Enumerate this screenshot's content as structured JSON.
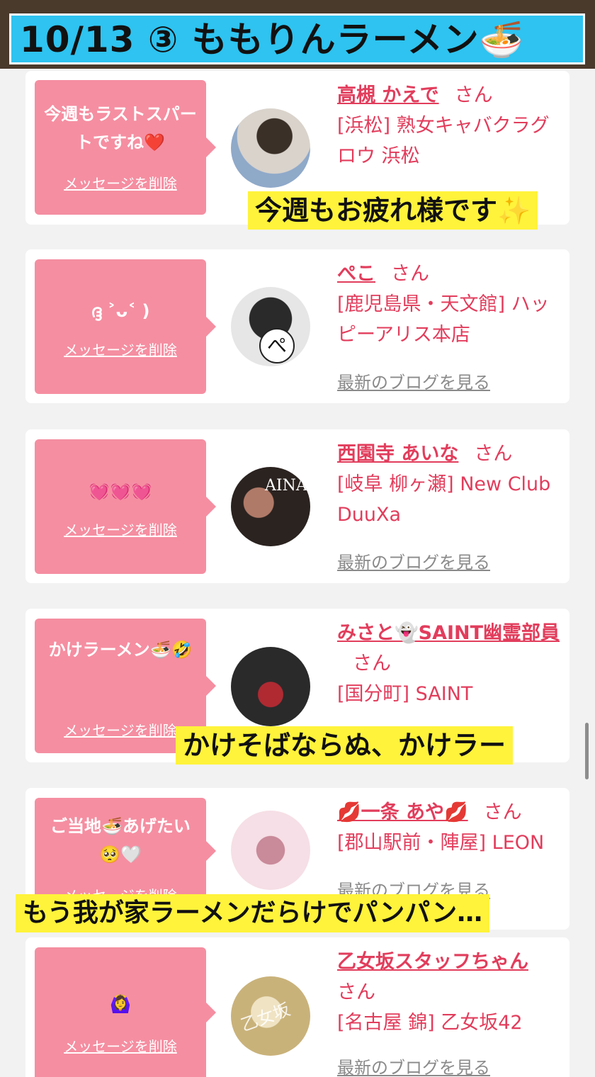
{
  "header": {
    "title": "10/13 ③ ももりんラーメン🍜"
  },
  "common": {
    "delete_label": "メッセージを削除",
    "san": "さん",
    "blog_label": "最新のブログを見る"
  },
  "cards": [
    {
      "message": "今週もラストスパートですね❤️",
      "name": "高槻 かえで",
      "shop": "[浜松] 熟女キャバクラグロウ 浜松"
    },
    {
      "message": "ദ്ദ ˃ᴗ˂ )",
      "name": "ぺこ",
      "shop": "[鹿児島県・天文館] ハッピーアリス本店"
    },
    {
      "message": "💓💓💓",
      "name": "西園寺 あいな",
      "shop": "[岐阜 柳ヶ瀬] New Club DuuXa"
    },
    {
      "message": "かけラーメン🍜🤣",
      "name": "みさと👻SAINT幽霊部員",
      "shop": "[国分町] SAINT"
    },
    {
      "message": "ご当地🍜あげたい🥺🤍",
      "name": "💋一条 あや💋",
      "shop": "[郡山駅前・陣屋] LEON"
    },
    {
      "message": "🙆‍♀️",
      "name": "乙女坂スタッフちゃん",
      "shop": "[名古屋 錦] 乙女坂42"
    }
  ],
  "captions": [
    "今週もお疲れ様です✨",
    "かけそばならぬ、かけラー",
    "もう我が家ラーメンだらけでパンパン…"
  ],
  "avatars": [
    {
      "icon": "profile-photo-hair-updo"
    },
    {
      "icon": "profile-photo-cat-ears",
      "badge": "ぺ"
    },
    {
      "icon": "profile-photo-aina",
      "badge": "AINA"
    },
    {
      "icon": "profile-photo-red-dress"
    },
    {
      "icon": "profile-photo-pink"
    },
    {
      "icon": "profile-photo-gold",
      "badge": "乙女坂"
    }
  ],
  "colors": {
    "brand_pink": "#f58ea1",
    "name_red": "#e23d5c",
    "title_cyan": "#2ec3f0",
    "caption_yellow": "#fff33b"
  }
}
